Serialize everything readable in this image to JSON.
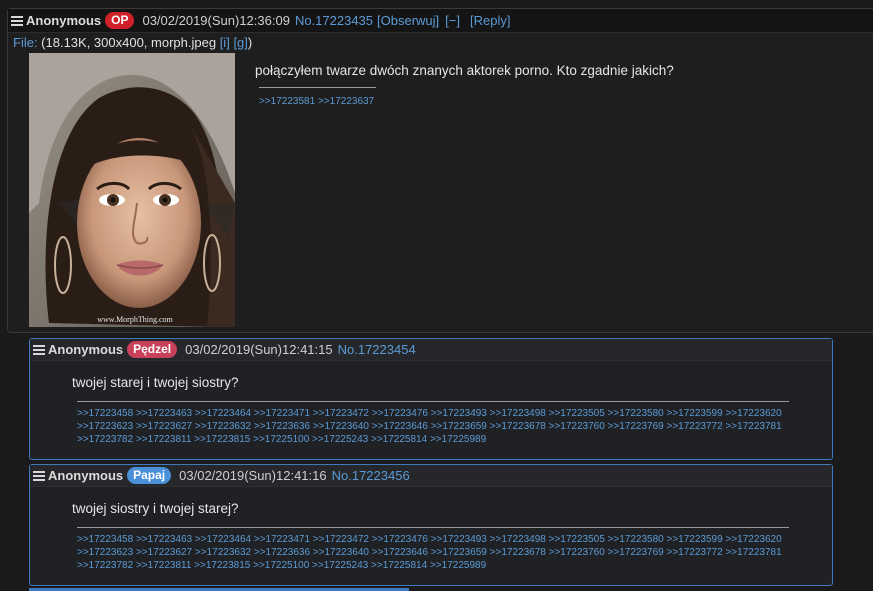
{
  "op": {
    "name": "Anonymous",
    "badge": "OP",
    "badge_color": "#d0202a",
    "date": "03/02/2019(Sun)12:36:09",
    "number": "No.17223435",
    "watch": "[Obserwuj]",
    "collapse": "[−]",
    "reply": "[Reply]",
    "file_label": "File:",
    "file_info": " (18.13K, 300x400, morph.jpeg ",
    "file_i": "[i]",
    "file_g": "[g]",
    "file_close": ")",
    "thumb_watermark": "www.MorphThing.com",
    "text": "połączyłem twarze dwóch znanych aktorek porno. Kto zgadnie jakich?",
    "backlinks": ">>17223581 >>17223637"
  },
  "replies": [
    {
      "name": "Anonymous",
      "badge": "Pędzel",
      "badge_color": "#c8405a",
      "date": "03/02/2019(Sun)12:41:15",
      "number": "No.17223454",
      "text": "twojej starej i twojej siostry?",
      "backlinks": [
        ">>17223458 >>17223463 >>17223464 >>17223471 >>17223472 >>17223476 >>17223493 >>17223498 >>17223505 >>17223580 >>17223599 >>17223620",
        ">>17223623 >>17223627 >>17223632 >>17223636 >>17223640 >>17223646 >>17223659 >>17223678 >>17223760 >>17223769 >>17223772 >>17223781",
        ">>17223782 >>17223811 >>17223815 >>17225100 >>17225243 >>17225814 >>17225989"
      ]
    },
    {
      "name": "Anonymous",
      "badge": "Papaj",
      "badge_color": "#4a90d9",
      "date": "03/02/2019(Sun)12:41:16",
      "number": "No.17223456",
      "text": "twojej siostry i twojej starej?",
      "backlinks": [
        ">>17223458 >>17223463 >>17223464 >>17223471 >>17223472 >>17223476 >>17223493 >>17223498 >>17223505 >>17223580 >>17223599 >>17223620",
        ">>17223623 >>17223627 >>17223632 >>17223636 >>17223640 >>17223646 >>17223659 >>17223678 >>17223760 >>17223769 >>17223772 >>17223781",
        ">>17223782 >>17223811 >>17223815 >>17225100 >>17225243 >>17225814 >>17225989"
      ]
    }
  ]
}
